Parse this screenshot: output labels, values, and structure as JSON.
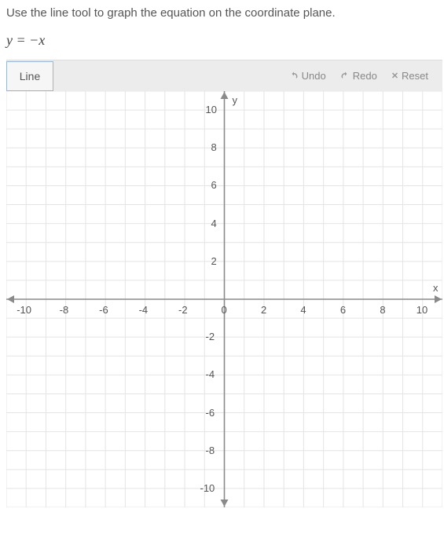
{
  "instruction": "Use the line tool to graph the equation on the coordinate plane.",
  "equation_lhs": "y",
  "equation_eq": " = ",
  "equation_rhs": "−x",
  "toolbar": {
    "line_label": "Line",
    "undo_label": "Undo",
    "redo_label": "Redo",
    "reset_label": "Reset"
  },
  "chart_data": {
    "type": "line",
    "title": "",
    "xlabel": "x",
    "ylabel": "y",
    "x_ticks": [
      -10,
      -8,
      -6,
      -4,
      -2,
      0,
      2,
      4,
      6,
      8,
      10
    ],
    "y_ticks": [
      -10,
      -8,
      -6,
      -4,
      -2,
      0,
      2,
      4,
      6,
      8,
      10
    ],
    "xlim": [
      -11,
      11
    ],
    "ylim": [
      -11,
      11
    ],
    "grid": true,
    "series": []
  }
}
